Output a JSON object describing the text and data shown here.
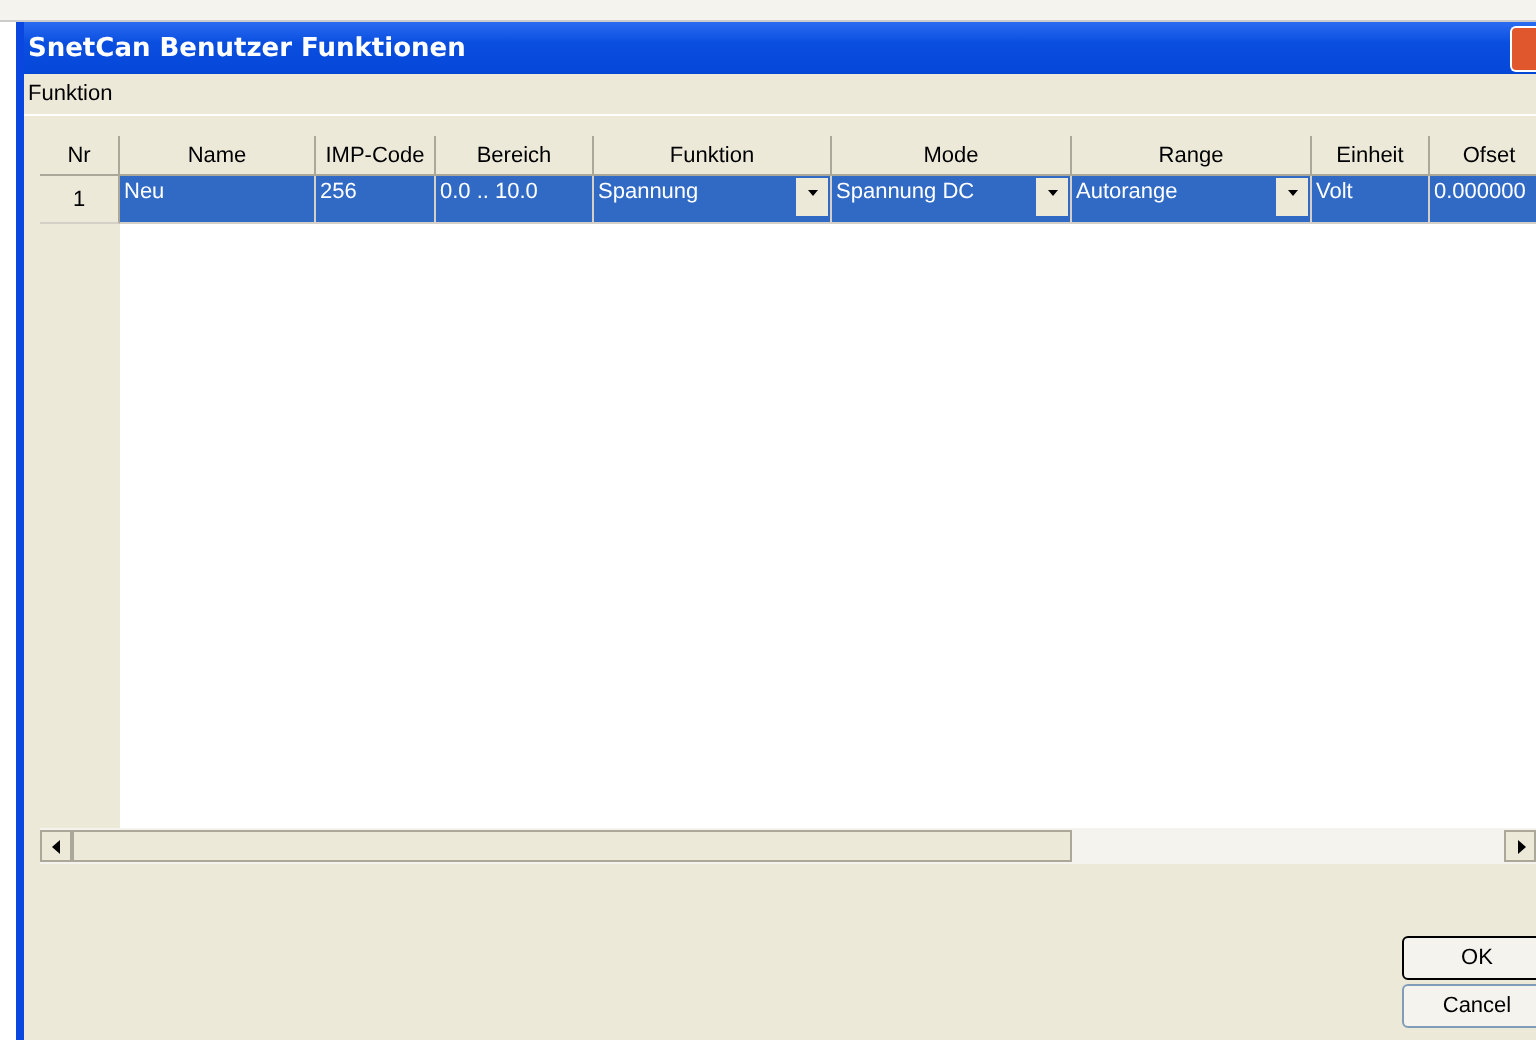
{
  "window": {
    "title": "SnetCan Benutzer Funktionen"
  },
  "menu": [
    {
      "label": "Funktion"
    }
  ],
  "table": {
    "columns": [
      "Nr",
      "Name",
      "IMP-Code",
      "Bereich",
      "Funktion",
      "Mode",
      "Range",
      "Einheit",
      "Ofset"
    ],
    "rows": [
      {
        "selected": true,
        "cells": [
          {
            "kind": "header",
            "text": "1"
          },
          {
            "kind": "text",
            "text": "Neu"
          },
          {
            "kind": "text",
            "text": "256"
          },
          {
            "kind": "text",
            "text": "0.0 .. 10.0"
          },
          {
            "kind": "dropdown",
            "text": "Spannung"
          },
          {
            "kind": "dropdown",
            "text": "Spannung DC"
          },
          {
            "kind": "dropdown",
            "text": "Autorange"
          },
          {
            "kind": "text",
            "text": "Volt"
          },
          {
            "kind": "text",
            "text": "0.000000"
          }
        ]
      }
    ]
  },
  "buttons": [
    {
      "label": "OK",
      "default": true
    },
    {
      "label": "Cancel",
      "default": false
    }
  ]
}
